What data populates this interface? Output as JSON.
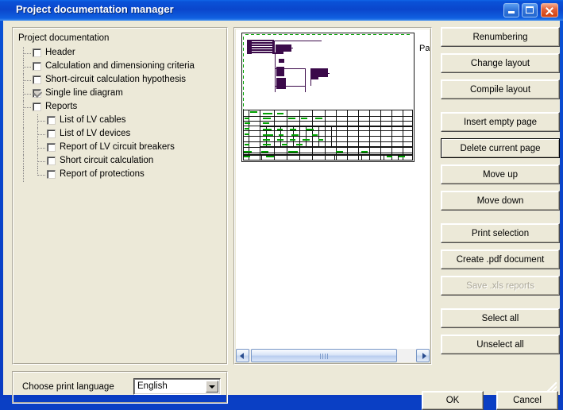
{
  "window": {
    "title": "Project documentation manager",
    "controls": {
      "minimize": "minimize",
      "maximize": "maximize",
      "close": "close"
    }
  },
  "tree": {
    "legend": "Project documentation",
    "items": [
      {
        "label": "Header",
        "checked": false,
        "depth": 1
      },
      {
        "label": "Calculation and dimensioning criteria",
        "checked": false,
        "depth": 1
      },
      {
        "label": "Short-circuit calculation hypothesis",
        "checked": false,
        "depth": 1
      },
      {
        "label": "Single line diagram",
        "checked": true,
        "depth": 1
      },
      {
        "label": "Reports",
        "checked": false,
        "depth": 1
      },
      {
        "label": "List of LV cables",
        "checked": false,
        "depth": 2
      },
      {
        "label": "List of LV devices",
        "checked": false,
        "depth": 2
      },
      {
        "label": "Report of LV circuit breakers",
        "checked": false,
        "depth": 2
      },
      {
        "label": "Short circuit calculation",
        "checked": false,
        "depth": 2
      },
      {
        "label": "Report of protections",
        "checked": false,
        "depth": 2
      }
    ]
  },
  "preview": {
    "page_label": "Pag",
    "scrollbar": {
      "left_arrow": "scroll-left",
      "right_arrow": "scroll-right"
    }
  },
  "language": {
    "label": "Choose print language",
    "value": "English"
  },
  "actions": [
    {
      "label": "Renumbering",
      "state": "normal"
    },
    {
      "label": "Change layout",
      "state": "normal"
    },
    {
      "label": "Compile layout",
      "state": "normal"
    },
    {
      "label": "Insert empty page",
      "state": "normal"
    },
    {
      "label": "Delete current page",
      "state": "default"
    },
    {
      "label": "Move up",
      "state": "normal"
    },
    {
      "label": "Move down",
      "state": "normal"
    },
    {
      "label": "Print selection",
      "state": "normal"
    },
    {
      "label": "Create .pdf document",
      "state": "normal"
    },
    {
      "label": "Save .xls reports",
      "state": "disabled"
    },
    {
      "label": "Select all",
      "state": "normal"
    },
    {
      "label": "Unselect all",
      "state": "normal"
    }
  ],
  "dialog_buttons": {
    "ok": "OK",
    "cancel": "Cancel"
  },
  "colors": {
    "titlebar_blue": "#0a46cc",
    "face": "#ece9d8",
    "schematic_purple": "#3b0a4a",
    "schematic_green": "#00a000",
    "close_red": "#d2410f"
  }
}
